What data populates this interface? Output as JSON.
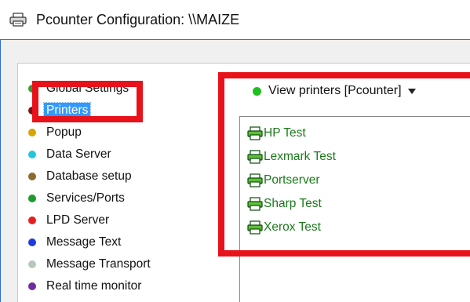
{
  "window": {
    "title": "Pcounter Configuration: \\\\MAIZE"
  },
  "tree": {
    "items": [
      {
        "label": "Global Settings",
        "color": "#2ea02e"
      },
      {
        "label": "Printers",
        "color": "#7a1616",
        "selected": true
      },
      {
        "label": "Popup",
        "color": "#d9a300"
      },
      {
        "label": "Data Server",
        "color": "#23c6dc"
      },
      {
        "label": "Database setup",
        "color": "#8b6a2b"
      },
      {
        "label": "Services/Ports",
        "color": "#1f9a2e"
      },
      {
        "label": "LPD Server",
        "color": "#e81f1f"
      },
      {
        "label": "Message Text",
        "color": "#1e3be0"
      },
      {
        "label": "Message Transport",
        "color": "#b8c8b8"
      },
      {
        "label": "Real time monitor",
        "color": "#6e2ca0"
      }
    ]
  },
  "view": {
    "label": "View printers [Pcounter]",
    "status_color": "#1fbf1f"
  },
  "printers": [
    {
      "name": "HP Test"
    },
    {
      "name": "Lexmark Test"
    },
    {
      "name": "Portserver"
    },
    {
      "name": "Sharp Test"
    },
    {
      "name": "Xerox Test"
    }
  ],
  "colors": {
    "highlight": "#e8121a",
    "selection": "#3399ff",
    "printer_text": "#1a7a1a"
  }
}
